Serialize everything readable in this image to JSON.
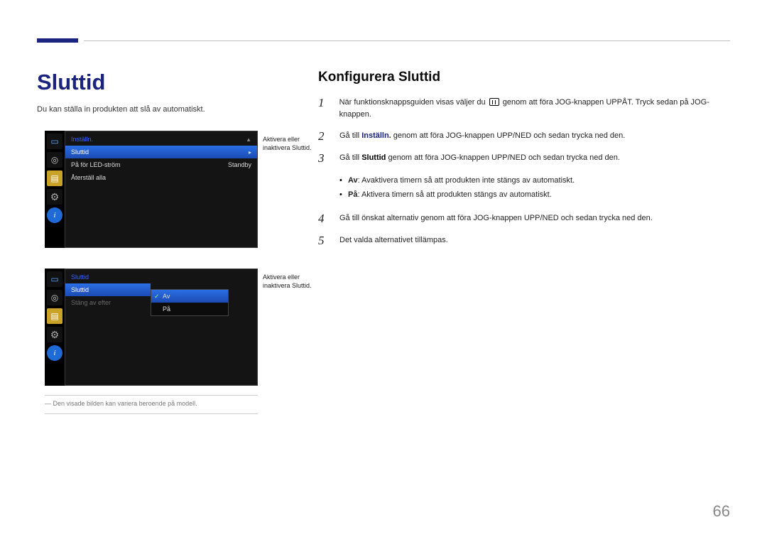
{
  "page_title": "Sluttid",
  "page_subtitle": "Du kan ställa in produkten att slå av automatiskt.",
  "right_title": "Konfigurera Sluttid",
  "panel1": {
    "header": "Inställn.",
    "rows": [
      {
        "label": "Sluttid",
        "value": "",
        "selected": true
      },
      {
        "label": "På för LED-ström",
        "value": "Standby",
        "selected": false
      },
      {
        "label": "Återställ alla",
        "value": "",
        "selected": false
      }
    ]
  },
  "panel1_tooltip": "Aktivera eller inaktivera Sluttid.",
  "panel2": {
    "header": "Sluttid",
    "rows": [
      {
        "label": "Sluttid",
        "selected": true
      },
      {
        "label": "Stäng av efter",
        "dim": true
      }
    ],
    "options": [
      {
        "label": "Av",
        "selected": true
      },
      {
        "label": "På"
      }
    ]
  },
  "panel2_tooltip": "Aktivera eller inaktivera Sluttid.",
  "footnote": "― Den visade bilden kan variera beroende på modell.",
  "steps": {
    "s1_a": "När funktionsknappsguiden visas väljer du ",
    "s1_b": " genom att föra JOG-knappen UPPÅT. Tryck sedan på JOG-knappen.",
    "s2_a": "Gå till ",
    "s2_kw": "Inställn.",
    "s2_b": " genom att föra JOG-knappen UPP/NED och sedan trycka ned den.",
    "s3_a": "Gå till ",
    "s3_kw": "Sluttid",
    "s3_b": " genom att föra JOG-knappen UPP/NED och sedan trycka ned den.",
    "b1_kw": "Av",
    "b1": ": Avaktivera timern så att produkten inte stängs av automatiskt.",
    "b2_kw": "På",
    "b2": ": Aktivera timern så att produkten stängs av automatiskt.",
    "s4": "Gå till önskat alternativ genom att föra JOG-knappen UPP/NED och sedan trycka ned den.",
    "s5": "Det valda alternativet tillämpas."
  },
  "page_number": "66"
}
